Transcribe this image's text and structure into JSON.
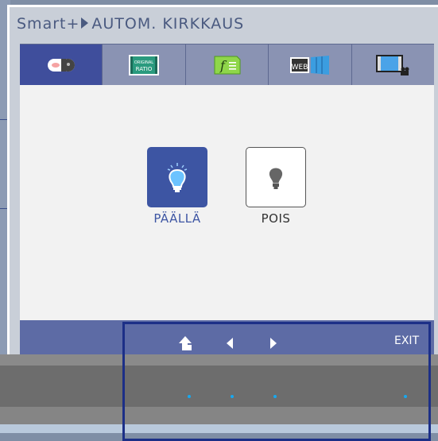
{
  "osd": {
    "breadcrumb_root": "Smart+",
    "breadcrumb_current": "AUTOM. KIRKKAUS"
  },
  "tabs": [
    {
      "icon": "auto-brightness-icon",
      "active": true
    },
    {
      "icon": "original-ratio-icon",
      "text": "ORIGINAL\nRATIO",
      "active": false
    },
    {
      "icon": "function-icon",
      "text": "f",
      "active": false
    },
    {
      "icon": "dual-web-icon",
      "text": "WEB",
      "active": false
    },
    {
      "icon": "screen-movie-icon",
      "active": false
    }
  ],
  "options": {
    "on_label": "PÄÄLLÄ",
    "off_label": "POIS",
    "selected": "on"
  },
  "footer": {
    "exit_label": "EXIT",
    "controls": [
      "up-arrow-icon",
      "left-arrow-icon",
      "right-arrow-icon"
    ]
  },
  "colors": {
    "accent": "#3d55a3",
    "led": "#17a8f0",
    "highlight_frame": "#1c2f87"
  }
}
